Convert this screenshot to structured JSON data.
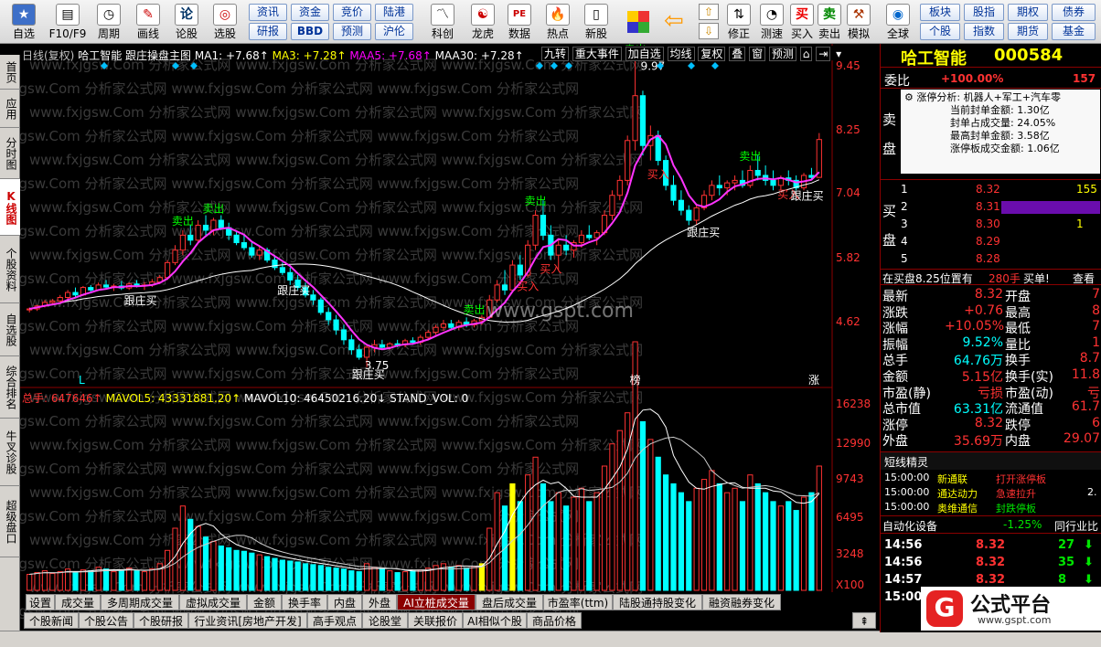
{
  "toolbar": {
    "items": [
      {
        "label": "自选",
        "icon": "★"
      },
      {
        "label": "F10/F9",
        "icon": "▤"
      },
      {
        "label": "周期",
        "icon": "◷"
      },
      {
        "label": "画线",
        "icon": "✎"
      },
      {
        "label": "论股",
        "icon": "论"
      },
      {
        "label": "选股",
        "icon": "◎"
      }
    ],
    "buttons": [
      {
        "label": "资讯"
      },
      {
        "label": "资金"
      },
      {
        "label": "竞价"
      },
      {
        "label": "陆港"
      },
      {
        "label": "研报"
      },
      {
        "label": "BBD"
      },
      {
        "label": "预测"
      },
      {
        "label": "沪伦"
      }
    ],
    "items2": [
      {
        "label": "科创",
        "icon": "〽"
      },
      {
        "label": "龙虎",
        "icon": "☯"
      },
      {
        "label": "数据",
        "icon": "PE"
      },
      {
        "label": "热点",
        "icon": "🔥"
      },
      {
        "label": "新股",
        "icon": "▯"
      }
    ],
    "items3": [
      {
        "label": "修正",
        "icon": "⇅"
      },
      {
        "label": "测速",
        "icon": "◔"
      },
      {
        "label": "买入",
        "icon": "买"
      },
      {
        "label": "卖出",
        "icon": "卖"
      },
      {
        "label": "模拟",
        "icon": "⚒"
      },
      {
        "label": "全球",
        "icon": "◉"
      }
    ],
    "buttons2": [
      {
        "label": "板块"
      },
      {
        "label": "股指"
      },
      {
        "label": "期权"
      },
      {
        "label": "债券"
      },
      {
        "label": "个股"
      },
      {
        "label": "指数"
      },
      {
        "label": "期货"
      },
      {
        "label": "基金"
      }
    ]
  },
  "leftnav": [
    "首页",
    "应用",
    "分时图",
    "K线图",
    "个股资料",
    "自选股",
    "综合排名",
    "牛叉诊股",
    "超级盘口"
  ],
  "chart_header": {
    "period": "日线(复权)",
    "stock": "哈工智能",
    "formula": "跟庄操盘主图",
    "ma1": "MA1: +7.68↑",
    "ma3": "MA3: +7.28↑",
    "maa5": "MAA5: +7.68↑",
    "maa30": "MAA30: +7.28↑"
  },
  "chart_tools": [
    "九转",
    "重大事件",
    "加自选",
    "均线",
    "复权",
    "叠",
    "窗",
    "预测"
  ],
  "watermark": "www.fxjgsw.Com 分析家公式网",
  "center_watermark": "www.gspt.com",
  "annotations": {
    "sell": "卖出",
    "buy": "买入",
    "follow": "跟庄买",
    "high_price": "9.97",
    "low_price": "3.75",
    "marker_l": "L",
    "marker_bang": "榜",
    "marker_zhang": "涨"
  },
  "price_axis": [
    "9.45",
    "8.25",
    "7.04",
    "5.82",
    "4.62"
  ],
  "vol_axis": [
    "16238",
    "12990",
    "9743",
    "6495",
    "3248",
    "X100"
  ],
  "vol_header": {
    "total": "总手: 647646↑",
    "mavol5": "MAVOL5: 43331881.20↑",
    "mavol10": "MAVOL10: 46450216.20↓",
    "std": "STAND_VOL: 0"
  },
  "chart_data": {
    "type": "bar",
    "candles": [
      [
        4.9,
        4.95,
        4.85,
        4.92
      ],
      [
        4.92,
        5.0,
        4.88,
        4.98
      ],
      [
        4.98,
        5.1,
        4.95,
        5.05
      ],
      [
        5.05,
        5.12,
        5.0,
        5.08
      ],
      [
        5.08,
        5.2,
        5.03,
        5.15
      ],
      [
        5.15,
        5.3,
        5.1,
        5.25
      ],
      [
        5.25,
        5.35,
        5.15,
        5.2
      ],
      [
        5.2,
        5.38,
        5.18,
        5.35
      ],
      [
        5.35,
        5.4,
        5.25,
        5.3
      ],
      [
        5.3,
        5.45,
        5.28,
        5.4
      ],
      [
        5.4,
        5.5,
        5.32,
        5.36
      ],
      [
        5.36,
        5.42,
        5.28,
        5.38
      ],
      [
        5.38,
        5.48,
        5.3,
        5.34
      ],
      [
        5.34,
        5.45,
        5.3,
        5.42
      ],
      [
        5.42,
        5.5,
        5.35,
        5.38
      ],
      [
        5.38,
        5.46,
        5.3,
        5.4
      ],
      [
        5.4,
        5.52,
        5.36,
        5.46
      ],
      [
        5.46,
        5.6,
        5.42,
        5.55
      ],
      [
        5.55,
        5.9,
        5.5,
        5.85
      ],
      [
        5.85,
        6.2,
        5.8,
        6.1
      ],
      [
        6.1,
        6.5,
        6.0,
        6.4
      ],
      [
        6.4,
        6.6,
        6.2,
        6.3
      ],
      [
        6.3,
        6.7,
        6.25,
        6.6
      ],
      [
        6.6,
        6.8,
        6.4,
        6.5
      ],
      [
        6.5,
        6.75,
        6.4,
        6.7
      ],
      [
        6.7,
        6.8,
        6.5,
        6.55
      ],
      [
        6.55,
        6.65,
        6.3,
        6.4
      ],
      [
        6.4,
        6.5,
        6.2,
        6.25
      ],
      [
        6.25,
        6.4,
        6.1,
        6.15
      ],
      [
        6.15,
        6.25,
        5.95,
        6.0
      ],
      [
        6.0,
        6.2,
        5.9,
        6.1
      ],
      [
        6.1,
        6.15,
        5.85,
        5.9
      ],
      [
        5.9,
        6.0,
        5.7,
        5.75
      ],
      [
        5.75,
        5.85,
        5.6,
        5.65
      ],
      [
        5.65,
        5.75,
        5.4,
        5.5
      ],
      [
        5.5,
        5.6,
        5.3,
        5.35
      ],
      [
        5.35,
        5.45,
        5.15,
        5.2
      ],
      [
        5.2,
        5.3,
        5.0,
        5.1
      ],
      [
        5.1,
        5.15,
        4.8,
        4.85
      ],
      [
        4.85,
        4.95,
        4.6,
        4.7
      ],
      [
        4.7,
        4.8,
        4.4,
        4.5
      ],
      [
        4.5,
        4.6,
        4.2,
        4.3
      ],
      [
        4.3,
        4.4,
        4.0,
        4.1
      ],
      [
        4.1,
        4.2,
        3.9,
        3.95
      ],
      [
        3.95,
        4.2,
        3.75,
        4.15
      ],
      [
        4.15,
        4.3,
        4.05,
        4.2
      ],
      [
        4.2,
        4.3,
        4.1,
        4.15
      ],
      [
        4.15,
        4.25,
        4.1,
        4.22
      ],
      [
        4.22,
        4.3,
        4.15,
        4.2
      ],
      [
        4.2,
        4.32,
        4.15,
        4.28
      ],
      [
        4.28,
        4.35,
        4.2,
        4.25
      ],
      [
        4.25,
        4.4,
        4.2,
        4.35
      ],
      [
        4.35,
        4.5,
        4.3,
        4.45
      ],
      [
        4.45,
        4.6,
        4.4,
        4.55
      ],
      [
        4.55,
        4.7,
        4.48,
        4.62
      ],
      [
        4.62,
        4.7,
        4.5,
        4.55
      ],
      [
        4.55,
        4.7,
        4.5,
        4.65
      ],
      [
        4.65,
        4.75,
        4.55,
        4.6
      ],
      [
        4.6,
        4.72,
        4.55,
        4.68
      ],
      [
        4.68,
        4.8,
        4.6,
        4.75
      ],
      [
        4.75,
        5.2,
        4.72,
        5.1
      ],
      [
        5.1,
        5.5,
        5.05,
        5.4
      ],
      [
        5.4,
        5.7,
        5.2,
        5.3
      ],
      [
        5.3,
        5.9,
        5.25,
        5.8
      ],
      [
        5.8,
        6.0,
        5.5,
        5.6
      ],
      [
        5.6,
        6.3,
        5.55,
        6.2
      ],
      [
        6.2,
        6.9,
        6.1,
        6.8
      ],
      [
        6.8,
        7.1,
        6.3,
        6.4
      ],
      [
        6.4,
        6.6,
        5.9,
        6.0
      ],
      [
        6.0,
        6.3,
        5.7,
        6.2
      ],
      [
        6.2,
        6.4,
        6.0,
        6.1
      ],
      [
        6.1,
        6.3,
        5.95,
        6.25
      ],
      [
        6.25,
        6.5,
        6.15,
        6.4
      ],
      [
        6.4,
        6.6,
        6.3,
        6.35
      ],
      [
        6.35,
        6.5,
        6.2,
        6.45
      ],
      [
        6.45,
        6.9,
        6.4,
        6.8
      ],
      [
        6.8,
        7.3,
        6.7,
        7.2
      ],
      [
        7.2,
        7.6,
        7.1,
        7.5
      ],
      [
        7.5,
        8.4,
        7.4,
        8.3
      ],
      [
        8.3,
        9.97,
        8.1,
        9.2
      ],
      [
        9.2,
        9.3,
        8.0,
        8.2
      ],
      [
        8.2,
        8.6,
        7.9,
        8.4
      ],
      [
        8.4,
        8.5,
        7.8,
        7.9
      ],
      [
        7.9,
        8.0,
        7.3,
        7.4
      ],
      [
        7.4,
        7.6,
        7.0,
        7.1
      ],
      [
        7.1,
        7.3,
        6.8,
        6.9
      ],
      [
        6.9,
        7.0,
        6.6,
        6.7
      ],
      [
        6.7,
        7.0,
        6.6,
        6.95
      ],
      [
        6.95,
        7.3,
        6.9,
        7.2
      ],
      [
        7.2,
        7.5,
        7.1,
        7.4
      ],
      [
        7.4,
        7.6,
        7.2,
        7.35
      ],
      [
        7.35,
        7.5,
        7.2,
        7.45
      ],
      [
        7.45,
        7.6,
        7.3,
        7.5
      ],
      [
        7.5,
        7.7,
        7.35,
        7.4
      ],
      [
        7.4,
        7.8,
        7.35,
        7.7
      ],
      [
        7.7,
        8.0,
        7.5,
        7.6
      ],
      [
        7.6,
        7.8,
        7.4,
        7.5
      ],
      [
        7.5,
        7.7,
        7.3,
        7.4
      ],
      [
        7.4,
        7.6,
        7.3,
        7.55
      ],
      [
        7.55,
        7.7,
        7.4,
        7.5
      ],
      [
        7.5,
        7.6,
        7.3,
        7.35
      ],
      [
        7.35,
        7.65,
        7.3,
        7.6
      ],
      [
        7.6,
        7.75,
        7.5,
        7.56
      ],
      [
        7.56,
        8.45,
        7.55,
        8.32
      ]
    ],
    "volumes": [
      18,
      20,
      22,
      19,
      21,
      24,
      20,
      23,
      22,
      26,
      24,
      21,
      23,
      25,
      22,
      21,
      24,
      30,
      45,
      70,
      95,
      80,
      72,
      60,
      55,
      50,
      48,
      45,
      44,
      42,
      40,
      38,
      36,
      34,
      33,
      32,
      30,
      29,
      28,
      26,
      25,
      24,
      22,
      21,
      30,
      26,
      24,
      22,
      20,
      21,
      22,
      23,
      25,
      28,
      30,
      26,
      28,
      25,
      27,
      30,
      70,
      110,
      95,
      120,
      100,
      130,
      150,
      120,
      100,
      110,
      95,
      105,
      115,
      100,
      110,
      140,
      165,
      180,
      200,
      280,
      190,
      170,
      150,
      130,
      120,
      110,
      100,
      115,
      125,
      135,
      120,
      110,
      115,
      100,
      130,
      120,
      110,
      100,
      95,
      100,
      90,
      105,
      110,
      140
    ]
  },
  "right": {
    "name": "哈工智能",
    "code": "000584",
    "weibi_label": "委比",
    "weibi_val": "+100.00%",
    "weibi_num": "157",
    "sell_label": "卖",
    "sell_label2": "盘",
    "buy_label": "买",
    "buy_label2": "盘",
    "zt_title": "涨停分析: 机器人+军工+汽车零",
    "zt_lines": [
      "当前封单金额: 1.30亿",
      "封单占成交量: 24.05%",
      "最高封单金额: 3.58亿",
      "涨停板成交金额: 1.06亿"
    ],
    "bids": [
      {
        "lvl": "1",
        "price": "8.32",
        "vol": "155"
      },
      {
        "lvl": "2",
        "price": "8.31",
        "vol": ""
      },
      {
        "lvl": "3",
        "price": "8.30",
        "vol": "1"
      },
      {
        "lvl": "4",
        "price": "8.29",
        "vol": ""
      },
      {
        "lvl": "5",
        "price": "8.28",
        "vol": ""
      }
    ],
    "bidline": {
      "text": "在买盘8.25位置有",
      "vol": "280手",
      "act": "买单!",
      "view": "查看"
    },
    "stats": [
      {
        "l": "最新",
        "v": "8.32",
        "l2": "开盘",
        "v2": "7"
      },
      {
        "l": "涨跌",
        "v": "+0.76",
        "l2": "最高",
        "v2": "8"
      },
      {
        "l": "涨幅",
        "v": "+10.05%",
        "l2": "最低",
        "v2": "7"
      },
      {
        "l": "振幅",
        "v": "9.52%",
        "l2": "量比",
        "v2": "1"
      },
      {
        "l": "总手",
        "v": "64.76万",
        "l2": "换手",
        "v2": "8.7"
      },
      {
        "l": "金额",
        "v": "5.15亿",
        "l2": "换手(实)",
        "v2": "11.8"
      },
      {
        "l": "市盈(静)",
        "v": "亏损",
        "l2": "市盈(动)",
        "v2": "亏"
      },
      {
        "l": "总市值",
        "v": "63.31亿",
        "l2": "流通值",
        "v2": "61.7"
      },
      {
        "l": "涨停",
        "v": "8.32",
        "l2": "跌停",
        "v2": "6"
      },
      {
        "l": "外盘",
        "v": "35.69万",
        "l2": "内盘",
        "v2": "29.07"
      }
    ],
    "elves_title": "短线精灵",
    "elves": [
      {
        "t": "15:00:00",
        "n": "新通联",
        "e": "打开涨停板"
      },
      {
        "t": "15:00:00",
        "n": "通达动力",
        "e": "急速拉升",
        "x": "2."
      },
      {
        "t": "15:00:00",
        "n": "奥维通信",
        "e": "封跌停板"
      }
    ],
    "sector": {
      "name": "自动化设备",
      "chg": "-1.25%",
      "cmp": "同行业比"
    },
    "ticks": [
      {
        "t": "14:56",
        "p": "8.32",
        "v": "27"
      },
      {
        "t": "14:56",
        "p": "8.32",
        "v": "35"
      },
      {
        "t": "14:57",
        "p": "8.32",
        "v": "8"
      },
      {
        "t": "15:00",
        "p": "",
        "v": ""
      }
    ],
    "logo_text": "公式平台",
    "logo_url": "www.gspt.com"
  },
  "tabs": [
    "设置",
    "成交量",
    "多周期成交量",
    "虚拟成交量",
    "金额",
    "换手率",
    "内盘",
    "外盘",
    "AI立桩成交量",
    "盘后成交量",
    "市盈率(ttm)",
    "陆股通持股变化",
    "融资融券变化"
  ],
  "tabs2": [
    "个股新闻",
    "个股公告",
    "个股研报",
    "行业资讯[房地产开发]",
    "高手观点",
    "论股堂",
    "关联报价",
    "AI相似个股",
    "商品价格"
  ]
}
